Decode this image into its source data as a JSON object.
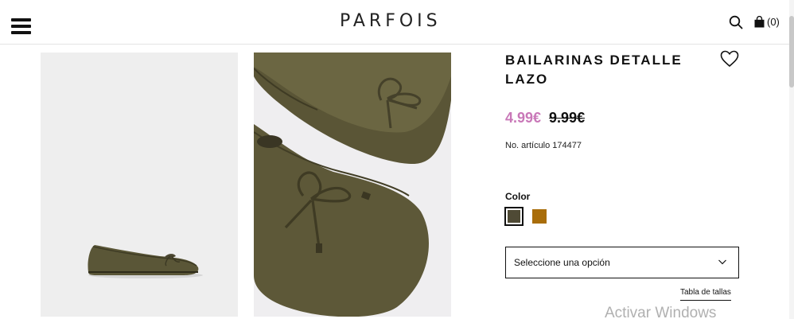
{
  "header": {
    "logo": "PARFOIS",
    "cart_count": "(0)"
  },
  "product": {
    "title": "BAILARINAS DETALLE LAZO",
    "price_sale": "4.99€",
    "price_original": "9.99€",
    "article_label": "No. artículo",
    "article_number": "174477"
  },
  "colors": {
    "label": "Color",
    "swatches": [
      {
        "name": "olive",
        "hex": "#4f4a35",
        "selected": true
      },
      {
        "name": "mustard",
        "hex": "#a96d0a",
        "selected": false
      }
    ]
  },
  "size_select": {
    "placeholder": "Seleccione una opción"
  },
  "size_guide": "Tabla de tallas",
  "os_watermark": "Activar Windows",
  "icons": {
    "menu": "hamburger-menu-icon",
    "search": "search-icon",
    "cart": "shopping-bag-icon",
    "wishlist": "heart-icon",
    "select": "chevron-down-icon"
  },
  "theme": {
    "sale_color": "#c978b8",
    "text_color": "#111111"
  }
}
